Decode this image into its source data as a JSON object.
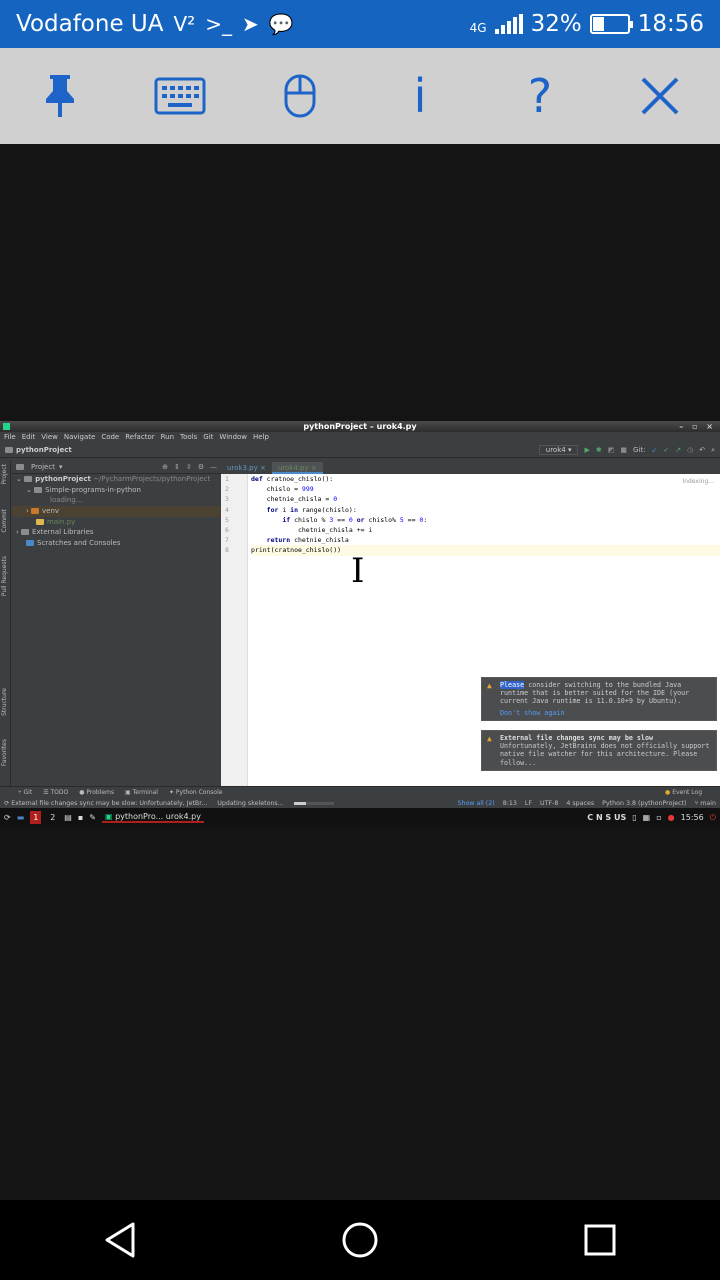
{
  "status_bar": {
    "carrier": "Vodafone UA",
    "network_type": "4G",
    "battery_percent": "32%",
    "battery_level": 0.32,
    "time": "18:56"
  },
  "toolbar": {
    "pin_icon": "pushpin-icon",
    "keyboard_icon": "keyboard-icon",
    "mouse_icon": "mouse-icon",
    "info_label": "i",
    "help_label": "?",
    "close_icon": "close-icon",
    "accent_color": "#1e64c8"
  },
  "ide": {
    "window_title": "pythonProject – urok4.py",
    "menu": [
      "File",
      "Edit",
      "View",
      "Navigate",
      "Code",
      "Refactor",
      "Run",
      "Tools",
      "Git",
      "Window",
      "Help"
    ],
    "nav_project": "pythonProject",
    "run_config": "urok4",
    "git_label": "Git:",
    "left_tabs": [
      "Project",
      "Commit",
      "Pull Requests",
      "Structure",
      "Favorites"
    ],
    "project_panel_title": "Project",
    "tree": {
      "root": "pythonProject",
      "root_path": "~/PycharmProjects/pythonProject",
      "child_folder": "Simple-programs-in-python",
      "loading": "loading...",
      "venv": "venv",
      "main_file": "main.py",
      "external_libraries": "External Libraries",
      "scratches": "Scratches and Consoles"
    },
    "editor_tabs": [
      "urok3.py",
      "urok4.py"
    ],
    "active_tab": "urok4.py",
    "indexing": "Indexing...",
    "line_numbers": [
      "1",
      "2",
      "3",
      "4",
      "5",
      "6",
      "7",
      "8"
    ],
    "code_lines": [
      "def cratnoe_chislo():",
      "    chislo = 999",
      "    chetnie_chisla = 0",
      "    for i in range(chislo):",
      "        if chislo % 3 == 0 or chislo% 5 == 0:",
      "            chetnie_chisla += i",
      "    return chetnie_chisla",
      "print(cratnoe_chislo())"
    ],
    "notification_1": {
      "highlight": "Please",
      "text": " consider switching to the bundled Java runtime that is better suited for the IDE (your current Java runtime is 11.0.10+9 by Ubuntu).",
      "link": "Don't show again"
    },
    "notification_2": {
      "title": "External file changes sync may be slow",
      "text": "Unfortunately, JetBrains does not officially support native file watcher for this architecture. Please follow..."
    },
    "bottom_tools": [
      "Git",
      "TODO",
      "Problems",
      "Terminal",
      "Python Console"
    ],
    "event_log": "Event Log",
    "status_message": "External file changes sync may be slow: Unfortunately, JetBr...",
    "status_task": "Updating skeletons...",
    "status_show_all": "Show all (2)",
    "cursor_pos": "8:13",
    "line_sep": "LF",
    "encoding": "UTF-8",
    "indent": "4 spaces",
    "interpreter": "Python 3.8 (pythonProject)",
    "branch": "main"
  },
  "desktop_taskbar": {
    "workspace_1": "1",
    "workspace_2": "2",
    "task": "pythonPro... urok4.py",
    "keyboard_layout": "C N S US",
    "time": "15:56"
  }
}
